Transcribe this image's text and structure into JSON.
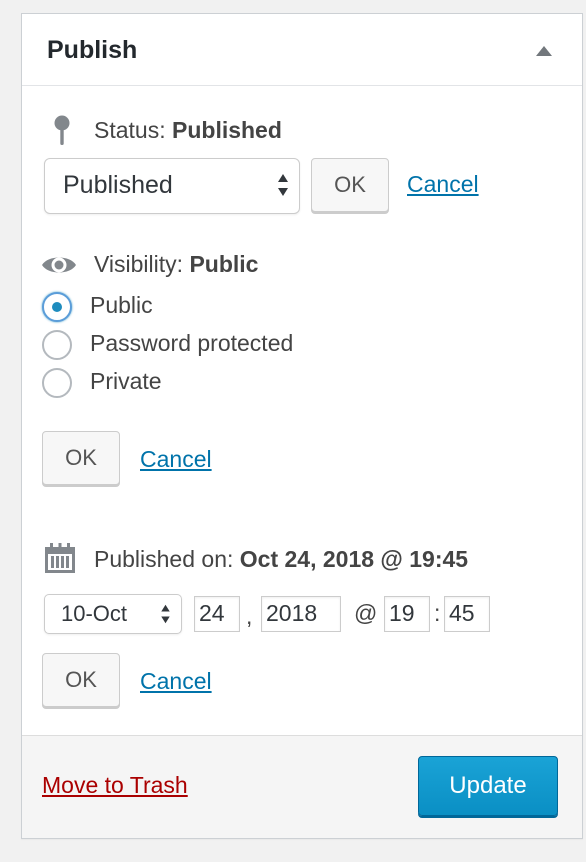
{
  "header": {
    "title": "Publish"
  },
  "status": {
    "label": "Status:",
    "value": "Published",
    "select_value": "Published",
    "ok_label": "OK",
    "cancel_label": "Cancel"
  },
  "visibility": {
    "label": "Visibility:",
    "value": "Public",
    "options": [
      "Public",
      "Password protected",
      "Private"
    ],
    "selected": "Public",
    "ok_label": "OK",
    "cancel_label": "Cancel"
  },
  "published_on": {
    "label": "Published on:",
    "value": "Oct 24, 2018 @ 19:45",
    "month_select": "10-Oct",
    "day": "24",
    "year": "2018",
    "at": "@",
    "hour": "19",
    "colon": ":",
    "minute": "45",
    "comma": ",",
    "ok_label": "OK",
    "cancel_label": "Cancel"
  },
  "footer": {
    "trash_label": "Move to Trash",
    "update_label": "Update"
  },
  "icons": {
    "status": "pin-icon",
    "visibility": "eye-icon",
    "date": "calendar-icon",
    "collapse": "triangle-up-icon"
  },
  "colors": {
    "link": "#0073aa",
    "trash": "#a00000",
    "primary_button": "#0085ba",
    "radio_checked": "#1e8cbe"
  }
}
